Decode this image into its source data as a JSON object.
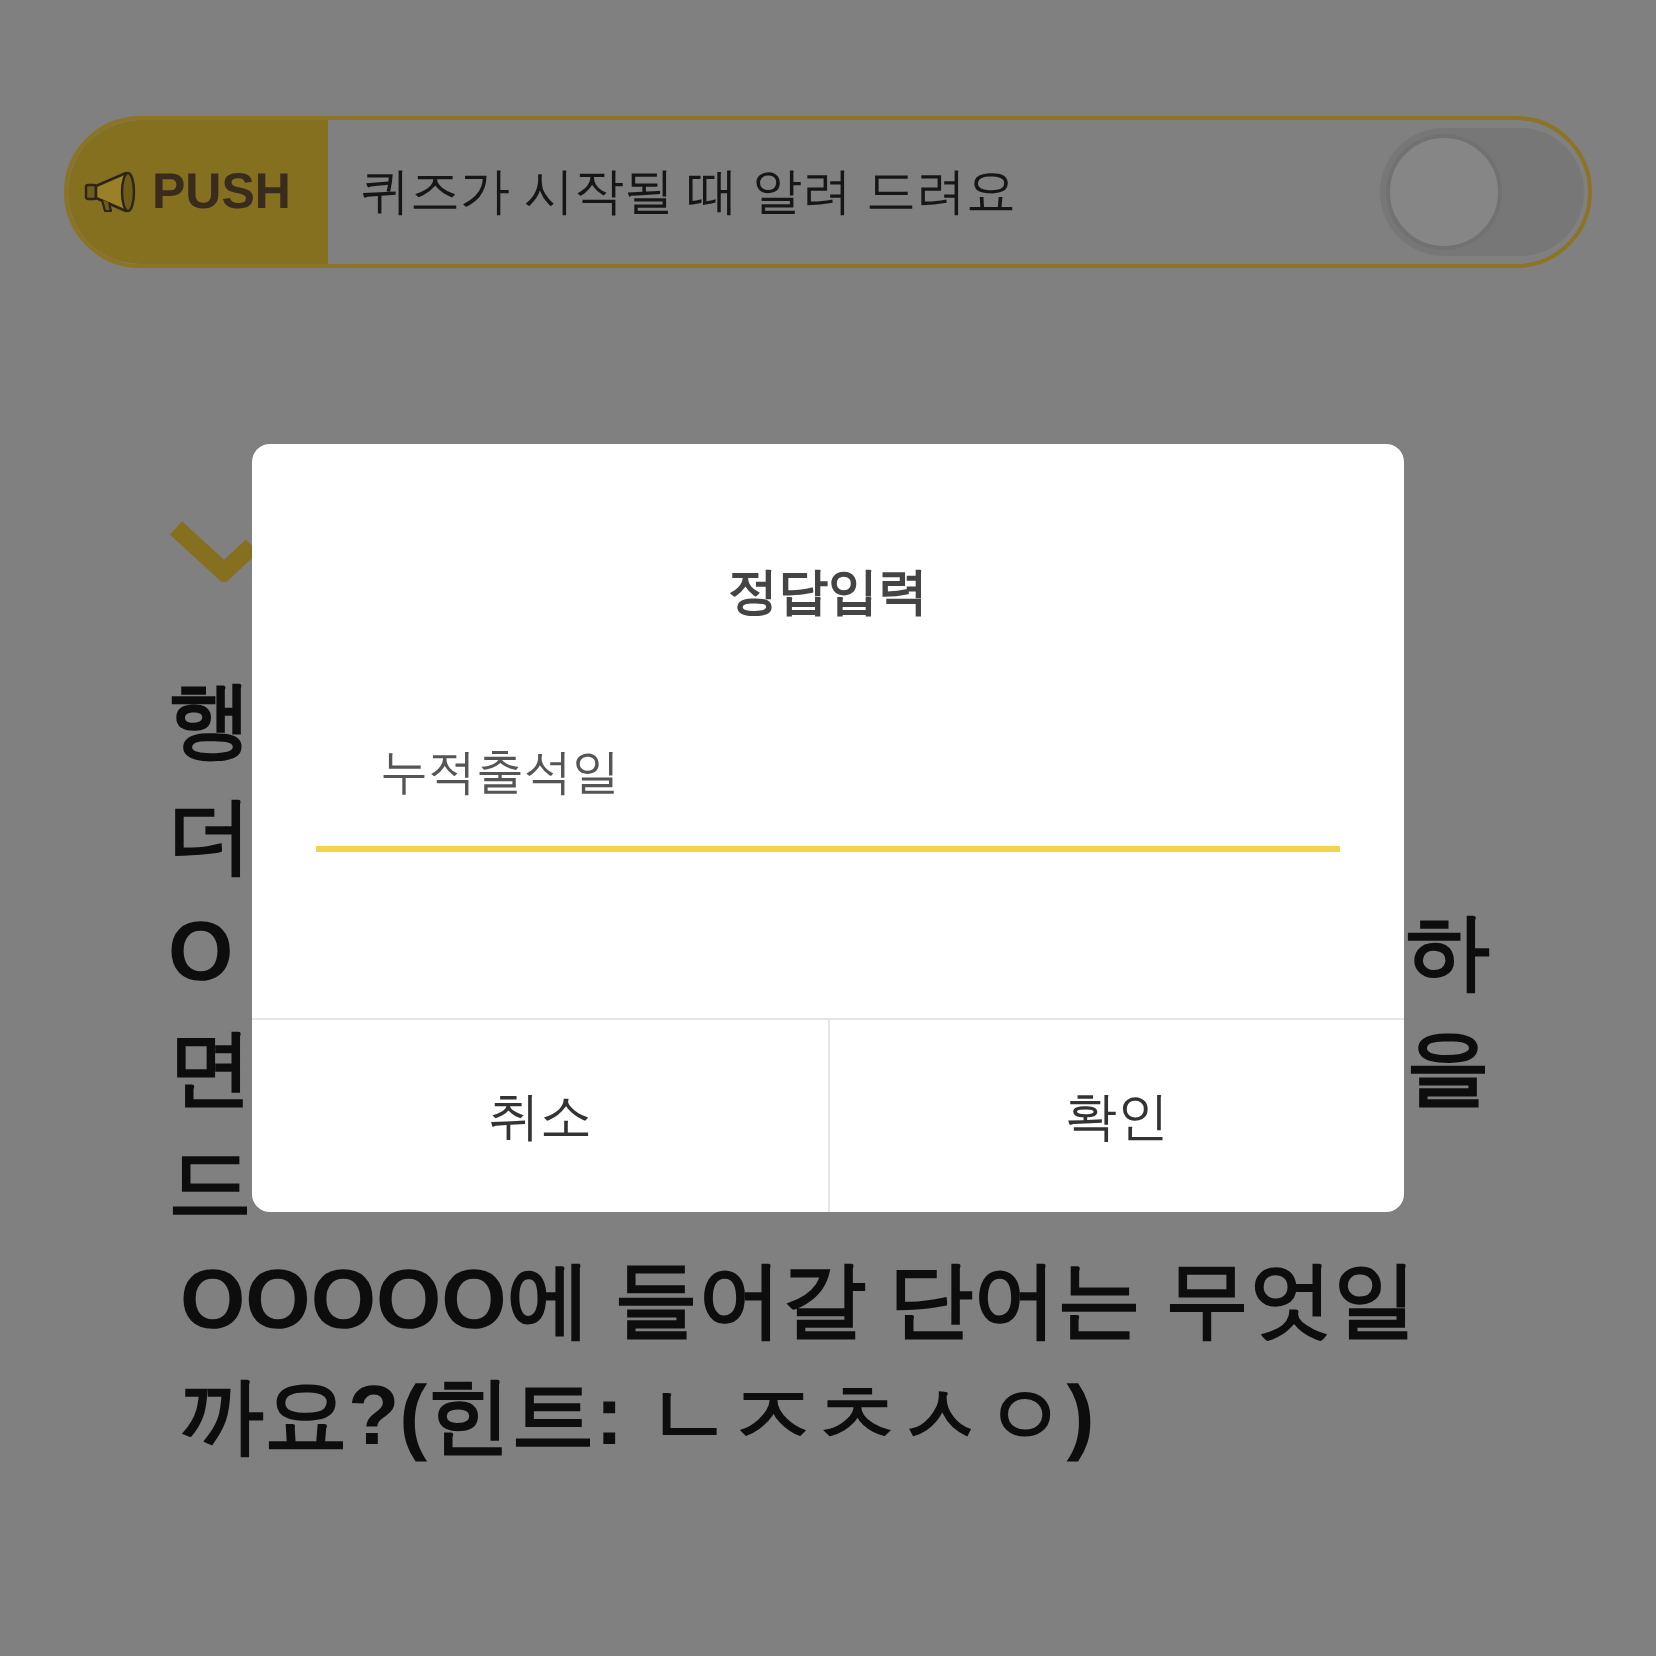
{
  "push_banner": {
    "badge": "PUSH",
    "message": "퀴즈가 시작될 때 알려 드려요",
    "toggle": {
      "on": false
    }
  },
  "question": {
    "visible_line_fragments": [
      {
        "left": "행"
      },
      {
        "left": "더"
      },
      {
        "left": "O",
        "right": "하"
      },
      {
        "left": "면",
        "right": "을"
      },
      {
        "left": "드"
      }
    ],
    "last_sentence": "OOOOO에 들어갈 단어는 무엇일까요?(힌트: ㄴㅈㅊㅅㅇ)"
  },
  "dialog": {
    "title": "정답입력",
    "answer": {
      "value": "누적출석일"
    },
    "buttons": [
      "취소",
      "확인"
    ]
  }
}
